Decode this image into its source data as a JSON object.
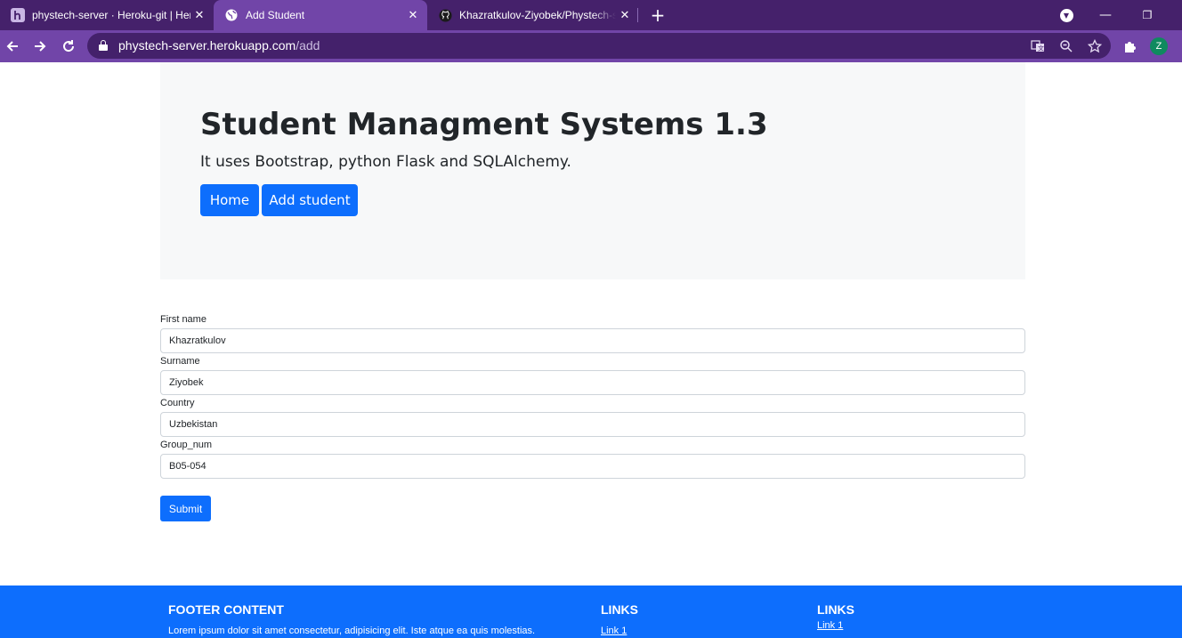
{
  "browser": {
    "tabs": [
      {
        "title": "phystech-server · Heroku-git | Her",
        "favicon": "heroku-icon",
        "active": false
      },
      {
        "title": "Add Student",
        "favicon": "globe-icon",
        "active": true
      },
      {
        "title": "Khazratkulov-Ziyobek/Phystech-s",
        "favicon": "github-icon",
        "active": false
      }
    ],
    "new_tab": "+",
    "close_glyph": "✕",
    "url_host": "phystech-server.herokuapp.com",
    "url_path": "/add",
    "profile_initial": "Z",
    "colors": {
      "tabbar": "#45216b",
      "toolbar": "#7145a8",
      "omnibox": "#44216b"
    }
  },
  "page": {
    "title": "Student Managment Systems 1.3",
    "lead": "It uses Bootstrap, python Flask and SQLAlchemy.",
    "nav": {
      "home": "Home",
      "add_student": "Add student"
    },
    "form": {
      "first_name_label": "First name",
      "first_name_value": "Khazratkulov",
      "surname_label": "Surname",
      "surname_value": "Ziyobek",
      "country_label": "Country",
      "country_value": "Uzbekistan",
      "group_label": "Group_num",
      "group_value": "B05-054",
      "submit": "Submit"
    },
    "footer": {
      "heading": "FOOTER CONTENT",
      "text": "Lorem ipsum dolor sit amet consectetur, adipisicing elit. Iste atque ea quis molestias.",
      "links_heading_1": "LINKS",
      "link_1a": "Link 1",
      "links_heading_2": "LINKS",
      "link_2a": "Link 1"
    },
    "colors": {
      "primary": "#0d6efd",
      "jumbotron_bg": "#f7f8f9"
    }
  }
}
